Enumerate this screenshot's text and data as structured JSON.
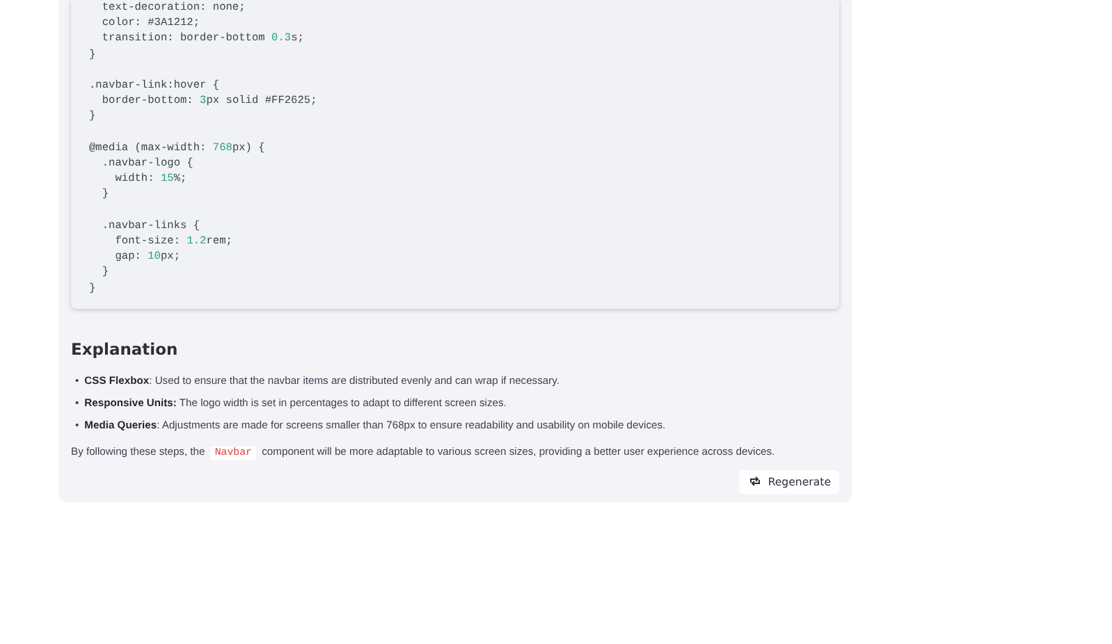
{
  "code_blocks": [
    [
      [
        {
          "kind": "text",
          "text": "  text-decoration: none;"
        }
      ],
      [
        {
          "kind": "text",
          "text": "  color: #3A1212;"
        }
      ],
      [
        {
          "kind": "text",
          "text": "  transition: border-bottom "
        },
        {
          "kind": "num",
          "text": "0.3"
        },
        {
          "kind": "text",
          "text": "s;"
        }
      ],
      [
        {
          "kind": "text",
          "text": "}"
        }
      ]
    ],
    [
      [
        {
          "kind": "text",
          "text": ".navbar-link:hover {"
        }
      ],
      [
        {
          "kind": "text",
          "text": "  border-bottom: "
        },
        {
          "kind": "num",
          "text": "3"
        },
        {
          "kind": "text",
          "text": "px solid #FF2625;"
        }
      ],
      [
        {
          "kind": "text",
          "text": "}"
        }
      ]
    ],
    [
      [
        {
          "kind": "text",
          "text": "@media (max-width: "
        },
        {
          "kind": "num",
          "text": "768"
        },
        {
          "kind": "text",
          "text": "px) {"
        }
      ],
      [
        {
          "kind": "text",
          "text": "  .navbar-logo {"
        }
      ],
      [
        {
          "kind": "text",
          "text": "    width: "
        },
        {
          "kind": "num",
          "text": "15"
        },
        {
          "kind": "text",
          "text": "%;"
        }
      ],
      [
        {
          "kind": "text",
          "text": "  }"
        }
      ]
    ],
    [
      [
        {
          "kind": "text",
          "text": "  .navbar-links {"
        }
      ],
      [
        {
          "kind": "text",
          "text": "    font-size: "
        },
        {
          "kind": "num",
          "text": "1.2"
        },
        {
          "kind": "text",
          "text": "rem;"
        }
      ],
      [
        {
          "kind": "text",
          "text": "    gap: "
        },
        {
          "kind": "num",
          "text": "10"
        },
        {
          "kind": "text",
          "text": "px;"
        }
      ],
      [
        {
          "kind": "text",
          "text": "  }"
        }
      ],
      [
        {
          "kind": "text",
          "text": "}"
        }
      ]
    ]
  ],
  "explanation": {
    "heading": "Explanation",
    "bullets": [
      {
        "marker": "•",
        "text": "**CSS Flexbox**: Used to ensure that the navbar items are distributed evenly and can wrap if necessary."
      },
      {
        "marker": "•",
        "text": "**Responsive Units:** The logo width is set in percentages to adapt to different screen sizes."
      },
      {
        "marker": "•",
        "text": "**Media Queries**: Adjustments are made for screens smaller than 768px to ensure readability and usability on mobile devices."
      }
    ],
    "paragraph": {
      "before": "By following these steps, the",
      "code": "Navbar",
      "after": "component will be more adaptable to various screen sizes, providing a better user experience across devices."
    }
  },
  "regenerate_button": "Regenerate"
}
